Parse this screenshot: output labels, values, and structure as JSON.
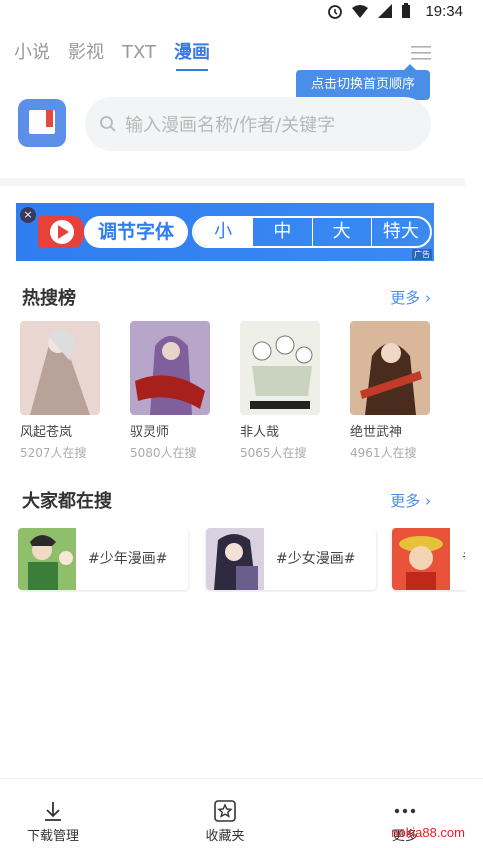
{
  "status_bar": {
    "time": "19:34"
  },
  "tabs": [
    {
      "label": "小说"
    },
    {
      "label": "影视"
    },
    {
      "label": "TXT"
    },
    {
      "label": "漫画"
    }
  ],
  "active_tab": "漫画",
  "tooltip": "点击切换首页顺序",
  "search": {
    "placeholder": "输入漫画名称/作者/关键字"
  },
  "ad": {
    "close": "×",
    "title": "调节字体",
    "sizes": [
      "小",
      "中",
      "大",
      "特大"
    ],
    "selected_size": "小",
    "tag": "广告"
  },
  "hot_section": {
    "title": "热搜榜",
    "more": "更多 ›",
    "items": [
      {
        "name": "风起苍岚",
        "count": "5207人在搜",
        "color": "#c9a8a0"
      },
      {
        "name": "驭灵师",
        "count": "5080人在搜",
        "color": "#8a6fa8"
      },
      {
        "name": "非人哉",
        "count": "5065人在搜",
        "color": "#d8dccf"
      },
      {
        "name": "绝世武神",
        "count": "4961人在搜",
        "color": "#8a5b3e"
      }
    ]
  },
  "popular_section": {
    "title": "大家都在搜",
    "more": "更多 ›",
    "tags": [
      {
        "label": "#少年漫画#",
        "color": "#5f8f4a"
      },
      {
        "label": "#少女漫画#",
        "color": "#7a6a8a"
      },
      {
        "label": "#",
        "color": "#d24a2e"
      }
    ]
  },
  "bottom_nav": [
    {
      "label": "下载管理",
      "icon": "download-icon"
    },
    {
      "label": "收藏夹",
      "icon": "star-box-icon"
    },
    {
      "label": "更多",
      "icon": "more-dots-icon"
    }
  ],
  "watermark": "nokia88.com",
  "colors": {
    "accent": "#3a7be0",
    "tooltip": "#4a8ee8",
    "ad": "#2f7df0"
  }
}
